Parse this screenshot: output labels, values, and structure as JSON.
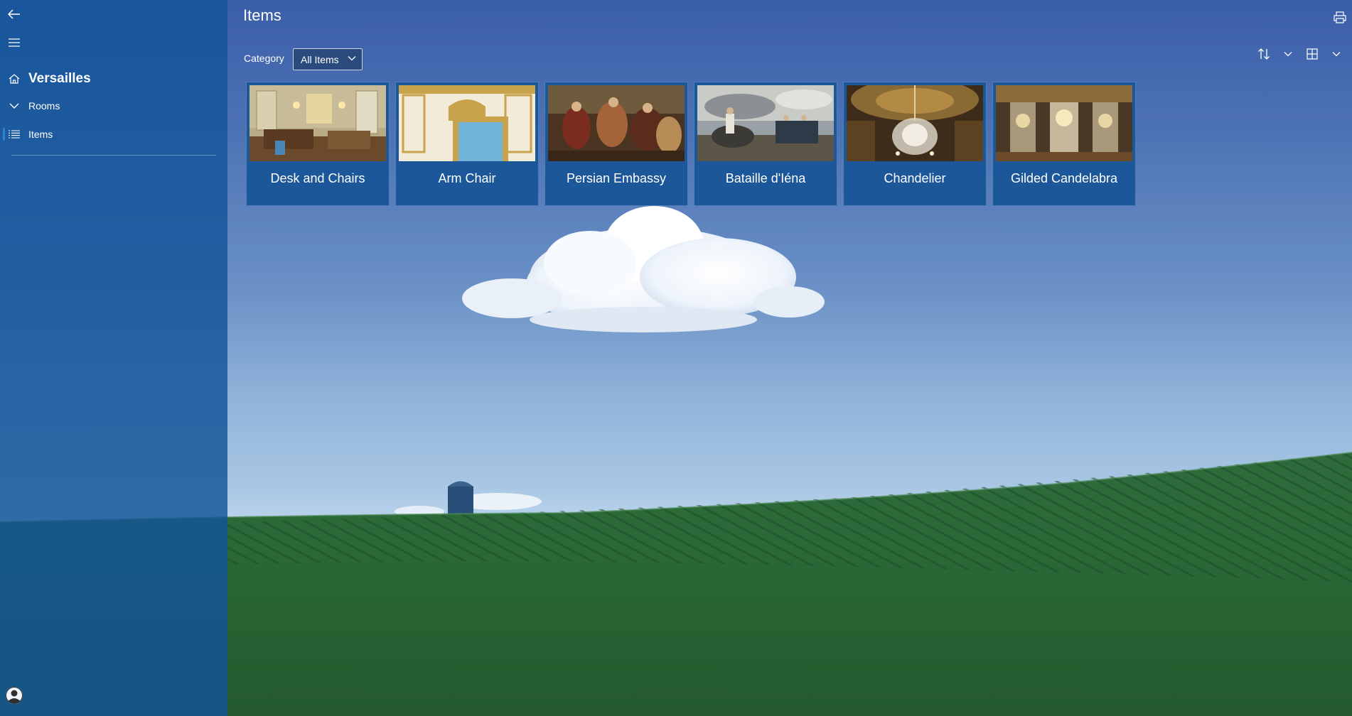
{
  "app": {
    "title": "Versailles"
  },
  "sidebar": {
    "back_icon": "back-arrow-icon",
    "menu_icon": "hamburger-icon",
    "home_icon": "home-icon",
    "title": "Versailles",
    "items": [
      {
        "label": "Rooms",
        "icon": "chevron-down-icon",
        "selected": false
      },
      {
        "label": "Items",
        "icon": "list-icon",
        "selected": true
      }
    ],
    "account_icon": "user-icon"
  },
  "header": {
    "title": "Items",
    "print_icon": "printer-icon"
  },
  "filter": {
    "label": "Category",
    "selected": "All Items"
  },
  "toolbar": {
    "sort_icon": "sort-icon",
    "view_icon": "grid-view-icon"
  },
  "cards": [
    {
      "title": "Desk and Chairs"
    },
    {
      "title": "Arm Chair"
    },
    {
      "title": "Persian Embassy"
    },
    {
      "title": "Bataille d'Iéna"
    },
    {
      "title": "Chandelier"
    },
    {
      "title": "Gilded Candelabra"
    }
  ],
  "colors": {
    "sidebar": "#1b5596",
    "card": "#1c5799",
    "accent": "#2c82d6"
  }
}
